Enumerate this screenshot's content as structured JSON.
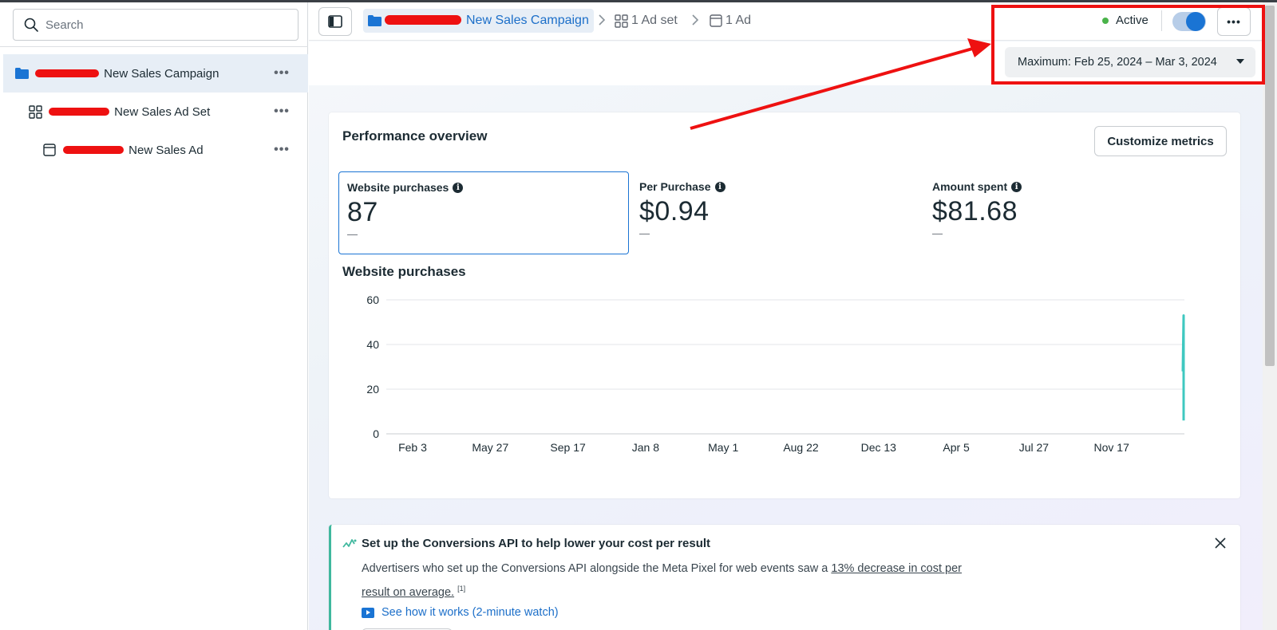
{
  "sidebar": {
    "search_placeholder": "Search",
    "items": [
      {
        "label": "New Sales Campaign",
        "type": "campaign",
        "selected": true
      },
      {
        "label": "New Sales Ad Set",
        "type": "ad-set",
        "selected": false
      },
      {
        "label": "New Sales Ad",
        "type": "ad",
        "selected": false
      }
    ]
  },
  "breadcrumb": {
    "campaign": "New Sales Campaign",
    "ad_set": "1 Ad set",
    "ad": "1 Ad"
  },
  "status": {
    "label": "Active",
    "toggle_on": true,
    "color": "#4ab34a"
  },
  "date_range": "Maximum: Feb 25, 2024 – Mar 3, 2024",
  "performance": {
    "title": "Performance overview",
    "customize_label": "Customize metrics",
    "metrics": [
      {
        "label": "Website purchases",
        "value": "87",
        "sub": "—",
        "selected": true
      },
      {
        "label": "Per Purchase",
        "value": "$0.94",
        "sub": "—",
        "selected": false
      },
      {
        "label": "Amount spent",
        "value": "$81.68",
        "sub": "—",
        "selected": false
      }
    ]
  },
  "chart_data": {
    "type": "line",
    "title": "Website purchases",
    "xlabel": "",
    "ylabel": "",
    "ylim": [
      0,
      60
    ],
    "y_ticks": [
      "60",
      "40",
      "20",
      "0"
    ],
    "x_ticks": [
      "Feb 3",
      "May 27",
      "Sep 17",
      "Jan 8",
      "May 1",
      "Aug 22",
      "Dec 13",
      "Apr 5",
      "Jul 27",
      "Nov 17"
    ],
    "series": [
      {
        "values": [
          6,
          53,
          28
        ],
        "color": "#3fc8c0"
      }
    ],
    "grid": true
  },
  "conversions_api": {
    "title": "Set up the Conversions API to help lower your cost per result",
    "body_prefix": "Advertisers who set up the Conversions API alongside the Meta Pixel for web events saw a ",
    "body_link": "13% decrease in cost per result on average.",
    "footnote": "[1]",
    "watch_label": "See how it works (2-minute watch)",
    "accent": "#3fb89e"
  },
  "colors": {
    "link_blue": "#1c6fc9",
    "primary_blue": "#1a74d4",
    "annotation_red": "#ee1111"
  }
}
